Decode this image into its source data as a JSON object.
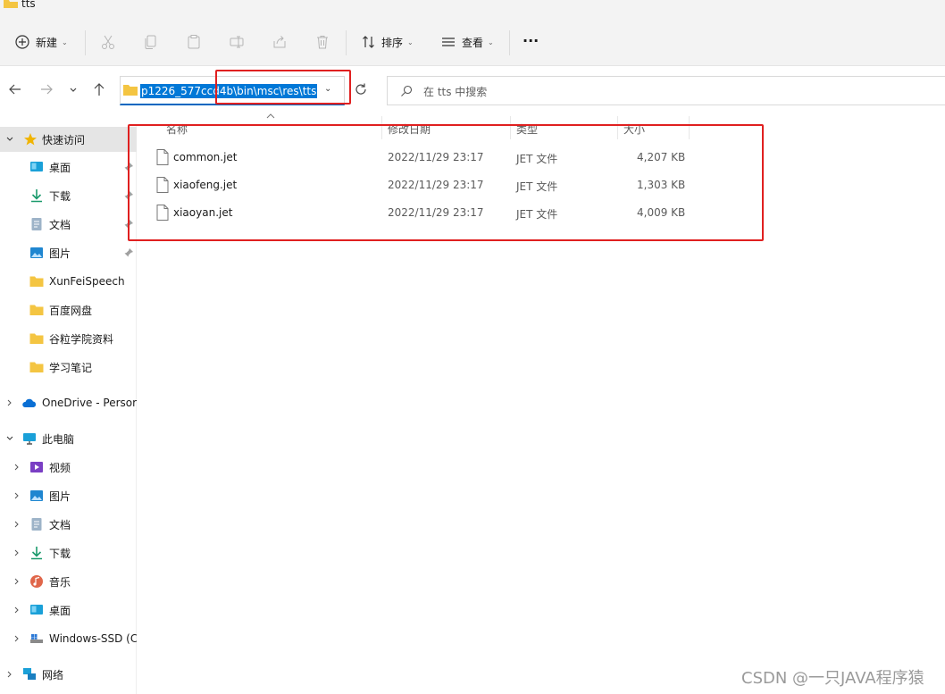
{
  "window": {
    "title": "tts"
  },
  "toolbar": {
    "new_label": "新建",
    "sort_label": "排序",
    "view_label": "查看",
    "more_label": "···"
  },
  "address_bar": {
    "path": "p1226_577ccd4b\\bin\\msc\\res\\tts"
  },
  "search": {
    "placeholder": "在 tts 中搜索"
  },
  "sidebar": {
    "quick_access": "快速访问",
    "quick_items": [
      {
        "label": "桌面",
        "icon": "desktop-icon"
      },
      {
        "label": "下载",
        "icon": "download-icon"
      },
      {
        "label": "文档",
        "icon": "document-icon"
      },
      {
        "label": "图片",
        "icon": "pictures-icon"
      },
      {
        "label": "XunFeiSpeech",
        "icon": "folder-icon"
      },
      {
        "label": "百度网盘",
        "icon": "folder-icon"
      },
      {
        "label": "谷粒学院资料",
        "icon": "folder-icon"
      },
      {
        "label": "学习笔记",
        "icon": "folder-icon"
      }
    ],
    "onedrive": "OneDrive - Persor",
    "this_pc": "此电脑",
    "pc_items": [
      {
        "label": "视频",
        "icon": "videos-icon"
      },
      {
        "label": "图片",
        "icon": "pictures-icon"
      },
      {
        "label": "文档",
        "icon": "document-icon"
      },
      {
        "label": "下载",
        "icon": "download-icon"
      },
      {
        "label": "音乐",
        "icon": "music-icon"
      },
      {
        "label": "桌面",
        "icon": "desktop-icon"
      },
      {
        "label": "Windows-SSD (C",
        "icon": "drive-icon"
      }
    ],
    "network": "网络"
  },
  "file_list": {
    "columns": [
      "名称",
      "修改日期",
      "类型",
      "大小"
    ],
    "rows": [
      {
        "name": "common.jet",
        "modified": "2022/11/29 23:17",
        "type": "JET 文件",
        "size": "4,207 KB"
      },
      {
        "name": "xiaofeng.jet",
        "modified": "2022/11/29 23:17",
        "type": "JET 文件",
        "size": "1,303 KB"
      },
      {
        "name": "xiaoyan.jet",
        "modified": "2022/11/29 23:17",
        "type": "JET 文件",
        "size": "4,009 KB"
      }
    ]
  },
  "watermark": "CSDN @一只JAVA程序猿",
  "colors": {
    "accent": "#0078d7",
    "annotation": "#e02020",
    "folder": "#f4c542"
  }
}
